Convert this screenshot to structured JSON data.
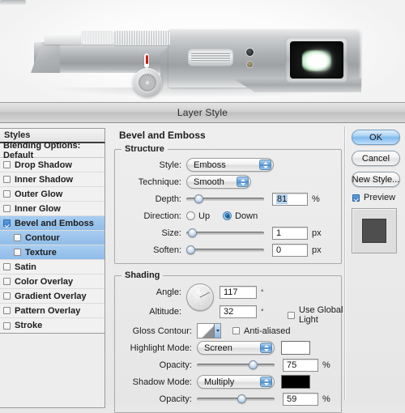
{
  "photo": {
    "alt_name": "silver-camera-product-photo",
    "parts": [
      "mode-dial",
      "knurled-dial",
      "film-advance-dial",
      "shutter-release-ring",
      "speaker-grille",
      "port",
      "viewfinder-lens"
    ]
  },
  "dialog": {
    "title": "Layer Style",
    "styles_panel": {
      "header": "Styles",
      "blending_options": "Blending Options: Default",
      "items": [
        {
          "label": "Drop Shadow",
          "checked": false,
          "sub": false,
          "selected": false
        },
        {
          "label": "Inner Shadow",
          "checked": false,
          "sub": false,
          "selected": false
        },
        {
          "label": "Outer Glow",
          "checked": false,
          "sub": false,
          "selected": false
        },
        {
          "label": "Inner Glow",
          "checked": false,
          "sub": false,
          "selected": false
        },
        {
          "label": "Bevel and Emboss",
          "checked": true,
          "sub": false,
          "selected": true
        },
        {
          "label": "Contour",
          "checked": false,
          "sub": true,
          "selected": true
        },
        {
          "label": "Texture",
          "checked": false,
          "sub": true,
          "selected": true
        },
        {
          "label": "Satin",
          "checked": false,
          "sub": false,
          "selected": false
        },
        {
          "label": "Color Overlay",
          "checked": false,
          "sub": false,
          "selected": false
        },
        {
          "label": "Gradient Overlay",
          "checked": false,
          "sub": false,
          "selected": false
        },
        {
          "label": "Pattern Overlay",
          "checked": false,
          "sub": false,
          "selected": false
        },
        {
          "label": "Stroke",
          "checked": false,
          "sub": false,
          "selected": false
        }
      ]
    },
    "main": {
      "section_title": "Bevel and Emboss",
      "structure": {
        "legend": "Structure",
        "style_label": "Style:",
        "style_value": "Emboss",
        "technique_label": "Technique:",
        "technique_value": "Smooth",
        "depth_label": "Depth:",
        "depth_value": "81",
        "depth_unit": "%",
        "depth_percent": 12,
        "direction_label": "Direction:",
        "direction_up": "Up",
        "direction_down": "Down",
        "direction_selected": "Down",
        "size_label": "Size:",
        "size_value": "1",
        "size_unit": "px",
        "size_percent": 2,
        "soften_label": "Soften:",
        "soften_value": "0",
        "soften_unit": "px",
        "soften_percent": 0
      },
      "shading": {
        "legend": "Shading",
        "angle_label": "Angle:",
        "angle_value": "117",
        "angle_unit": "°",
        "use_global_light": "Use Global Light",
        "use_global_light_checked": false,
        "altitude_label": "Altitude:",
        "altitude_value": "32",
        "altitude_unit": "°",
        "gloss_contour_label": "Gloss Contour:",
        "anti_aliased": "Anti-aliased",
        "anti_aliased_checked": false,
        "highlight_mode_label": "Highlight Mode:",
        "highlight_mode_value": "Screen",
        "highlight_color": "#ffffff",
        "highlight_opacity_label": "Opacity:",
        "highlight_opacity_value": "75",
        "highlight_opacity_unit": "%",
        "highlight_opacity_percent": 75,
        "shadow_mode_label": "Shadow Mode:",
        "shadow_mode_value": "Multiply",
        "shadow_color": "#000000",
        "shadow_opacity_label": "Opacity:",
        "shadow_opacity_value": "59",
        "shadow_opacity_unit": "%",
        "shadow_opacity_percent": 59
      }
    },
    "buttons": {
      "ok": "OK",
      "cancel": "Cancel",
      "new_style": "New Style...",
      "preview": "Preview",
      "preview_checked": true
    },
    "colors": {
      "accent": "#7fbaee",
      "selection": "#a8cdf0",
      "titlebar": "#c8c8c8",
      "panel": "#ededed",
      "thumbnail": "#4e4e4e"
    }
  }
}
